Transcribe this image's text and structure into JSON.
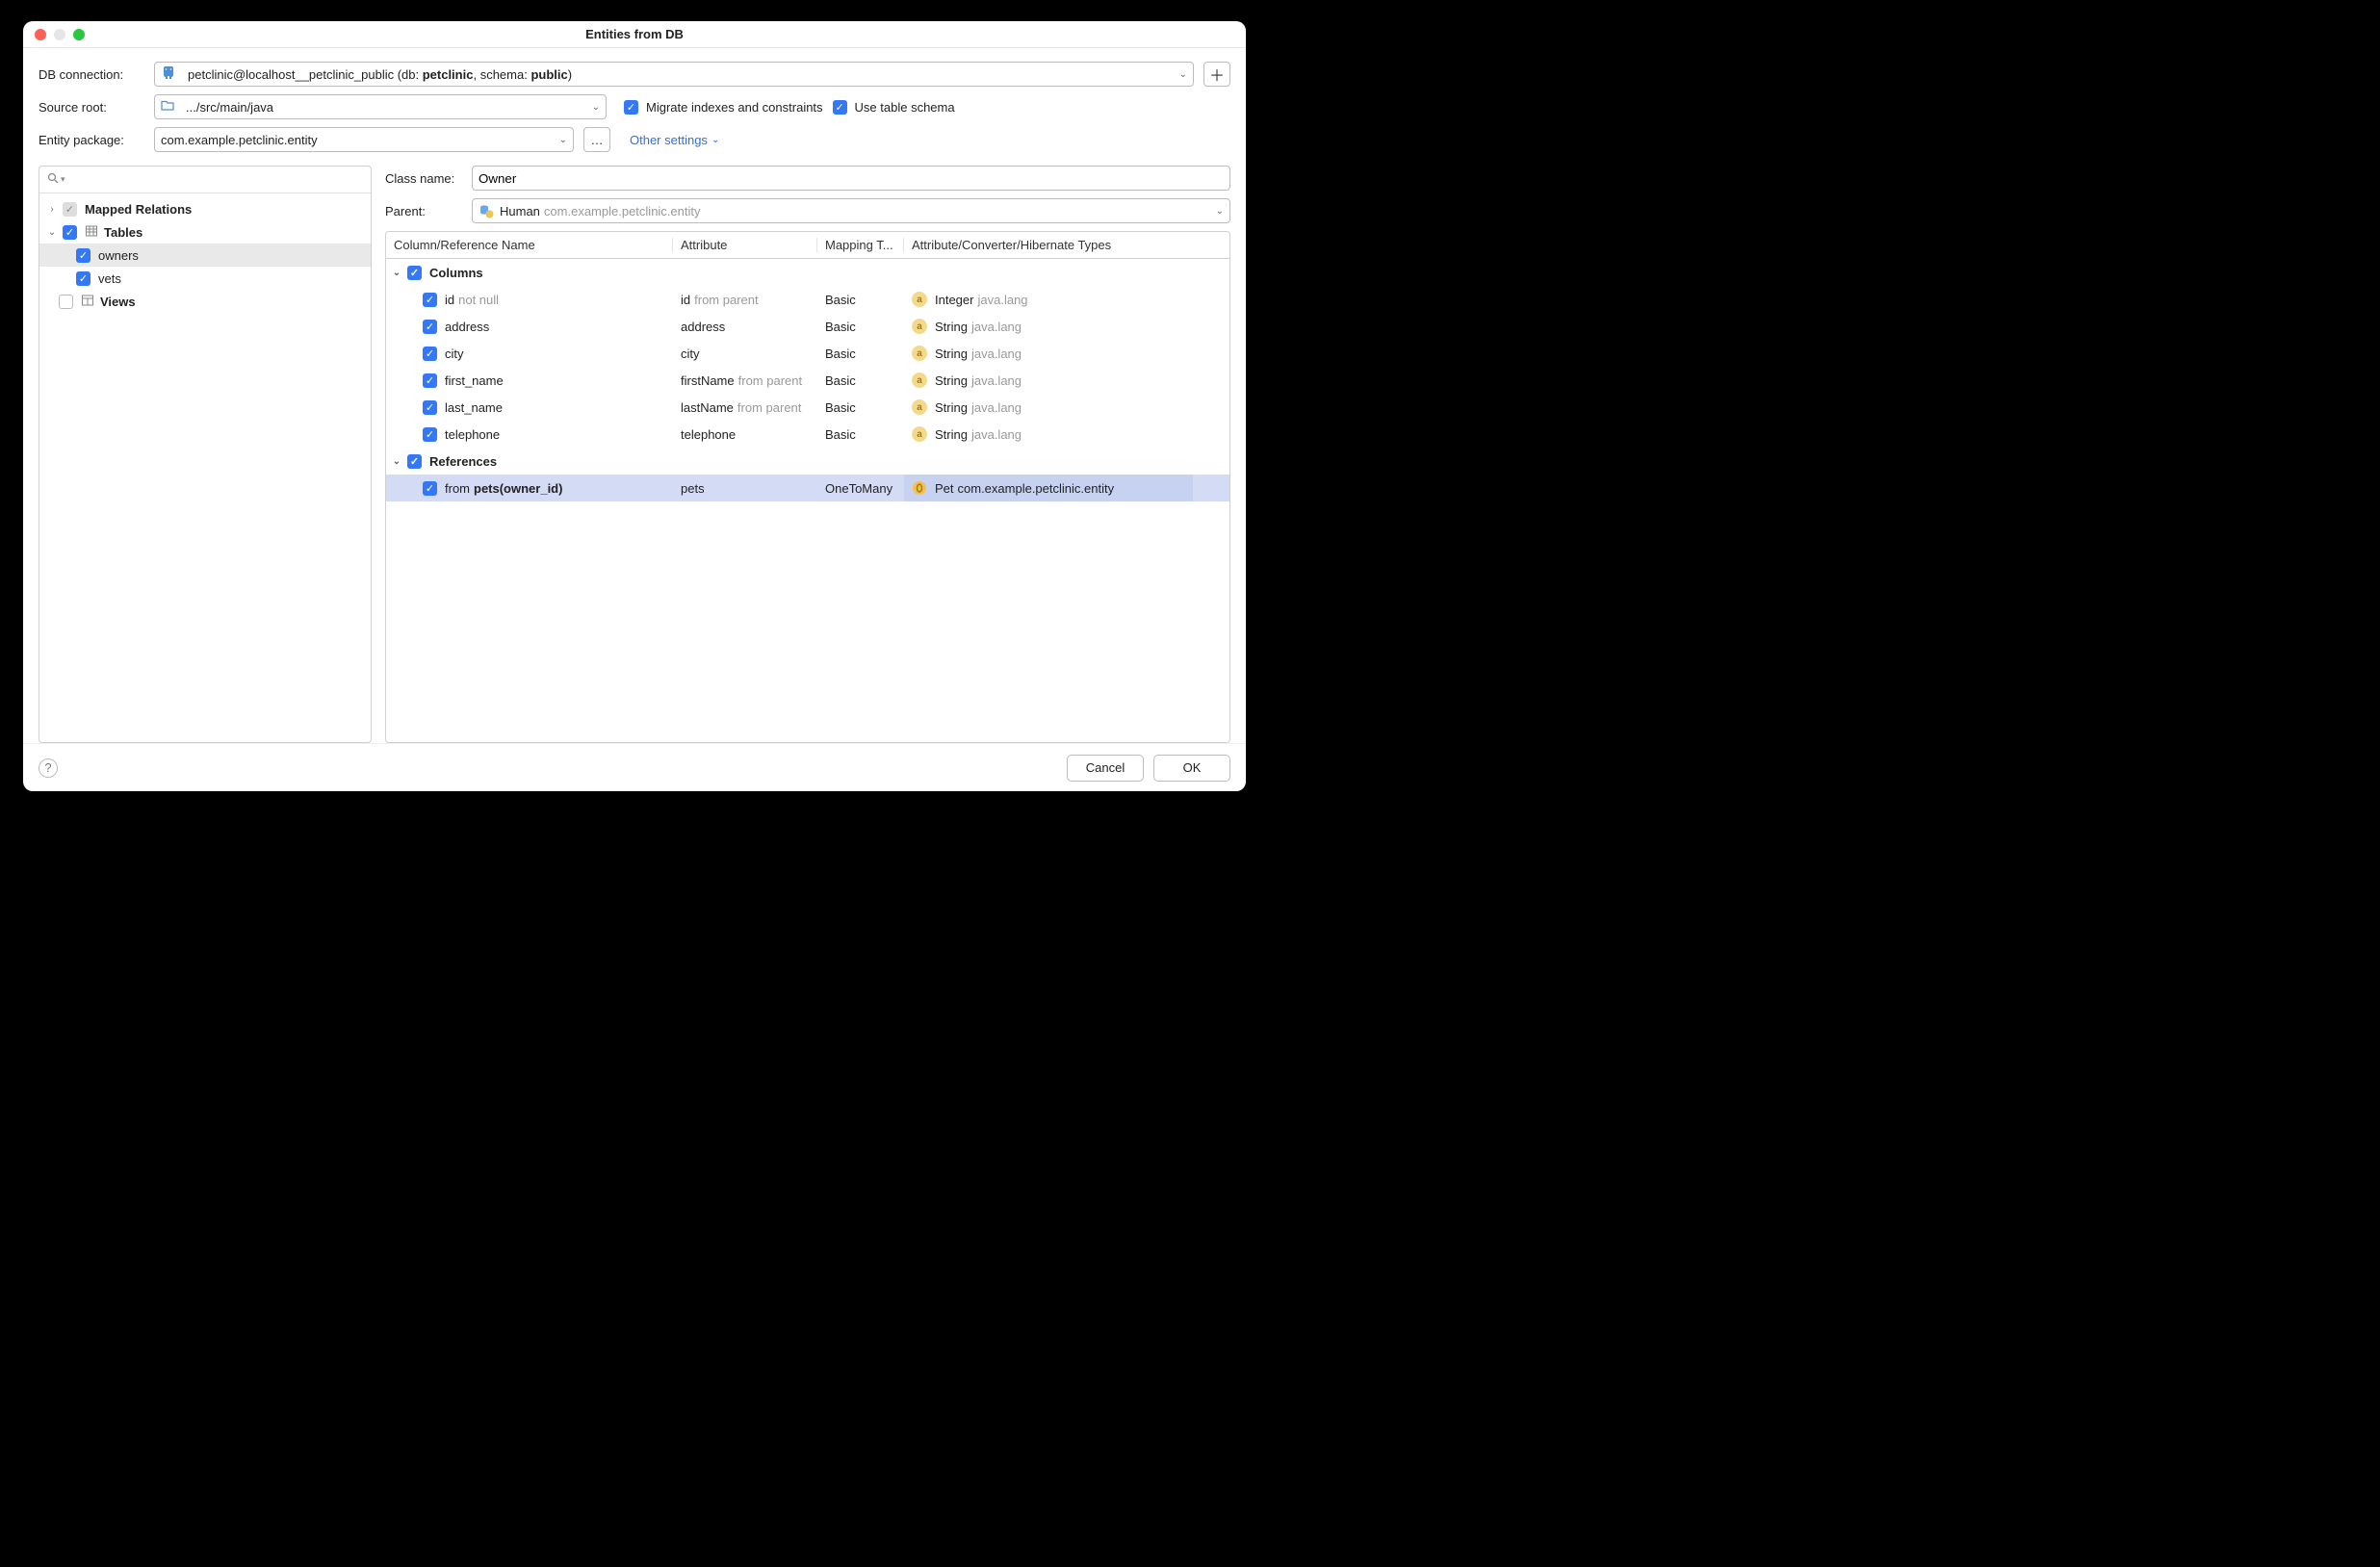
{
  "title": "Entities from DB",
  "labels": {
    "db_connection": "DB connection:",
    "source_root": "Source root:",
    "entity_package": "Entity package:",
    "class_name": "Class name:",
    "parent": "Parent:"
  },
  "db_connection": {
    "prefix": "petclinic@localhost__petclinic_public (db: ",
    "bold1": "petclinic",
    "mid": ", schema: ",
    "bold2": "public",
    "suffix": ")"
  },
  "source_root": ".../src/main/java",
  "checks": {
    "migrate": "Migrate indexes and constraints",
    "use_table_schema": "Use table schema"
  },
  "entity_package": "com.example.petclinic.entity",
  "other_settings": "Other settings",
  "tree": {
    "mapped_relations": "Mapped Relations",
    "tables": "Tables",
    "owners": "owners",
    "vets": "vets",
    "views": "Views"
  },
  "class_name": "Owner",
  "parent": {
    "name": "Human",
    "pkg": "com.example.petclinic.entity"
  },
  "grid": {
    "headers": {
      "col1": "Column/Reference Name",
      "col2": "Attribute",
      "col3": "Mapping T...",
      "col4": "Attribute/Converter/Hibernate Types"
    },
    "sections": {
      "columns": "Columns",
      "references": "References"
    },
    "rows": [
      {
        "name": "id",
        "suffix": "not null",
        "attr": "id",
        "attr_suffix": "from parent",
        "mapping": "Basic",
        "type": "Integer",
        "type_pkg": "java.lang",
        "icon": "a"
      },
      {
        "name": "address",
        "attr": "address",
        "mapping": "Basic",
        "type": "String",
        "type_pkg": "java.lang",
        "icon": "a"
      },
      {
        "name": "city",
        "attr": "city",
        "mapping": "Basic",
        "type": "String",
        "type_pkg": "java.lang",
        "icon": "a"
      },
      {
        "name": "first_name",
        "attr": "firstName",
        "attr_suffix": "from parent",
        "mapping": "Basic",
        "type": "String",
        "type_pkg": "java.lang",
        "icon": "a"
      },
      {
        "name": "last_name",
        "attr": "lastName",
        "attr_suffix": "from parent",
        "mapping": "Basic",
        "type": "String",
        "type_pkg": "java.lang",
        "icon": "a"
      },
      {
        "name": "telephone",
        "attr": "telephone",
        "mapping": "Basic",
        "type": "String",
        "type_pkg": "java.lang",
        "icon": "a"
      }
    ],
    "ref_row": {
      "prefix": "from ",
      "bold": "pets(owner_id)",
      "attr": "pets",
      "mapping": "OneToMany",
      "type": "Pet",
      "type_pkg": "com.example.petclinic.entity"
    }
  },
  "buttons": {
    "cancel": "Cancel",
    "ok": "OK"
  }
}
